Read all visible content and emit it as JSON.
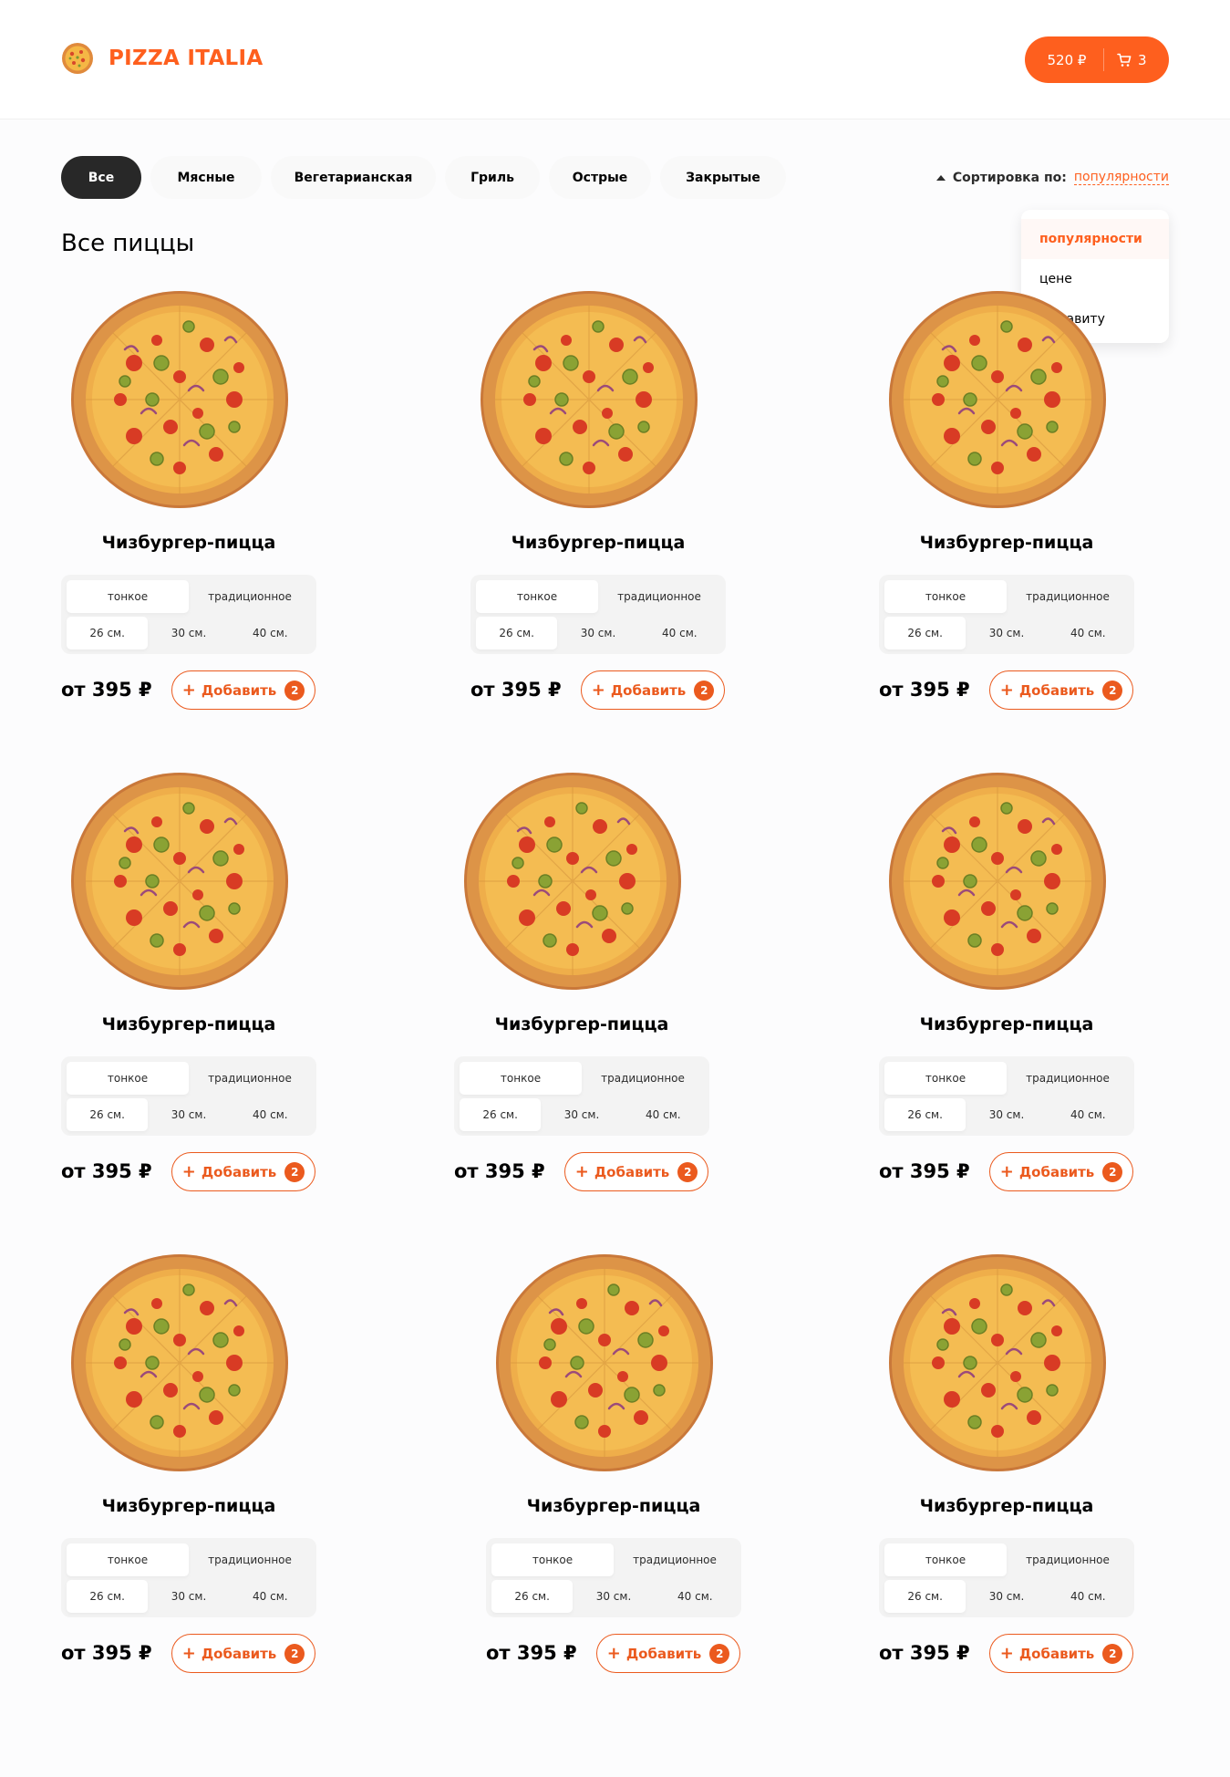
{
  "header": {
    "logo_text": "PIZZA ITALIA",
    "cart": {
      "price": "520 ₽",
      "count": "3"
    }
  },
  "categories": [
    {
      "label": "Все",
      "active": true
    },
    {
      "label": "Мясные"
    },
    {
      "label": "Вегетарианская"
    },
    {
      "label": "Гриль"
    },
    {
      "label": "Острые"
    },
    {
      "label": "Закрытые"
    }
  ],
  "sort": {
    "label": "Сортировка по:",
    "value": "популярности",
    "options": [
      "популярности",
      "цене",
      "алфавиту"
    ]
  },
  "section_title": "Все пиццы",
  "pizza_card": {
    "title": "Чизбургер-пицца",
    "dough_types": [
      "тонкое",
      "традиционное"
    ],
    "sizes": [
      "26 см.",
      "30 см.",
      "40 см."
    ],
    "price": "от 395 ₽",
    "add_label": "Добавить",
    "add_count": "2"
  },
  "colors": {
    "accent": "#fe5f1e",
    "dark": "#282828"
  }
}
